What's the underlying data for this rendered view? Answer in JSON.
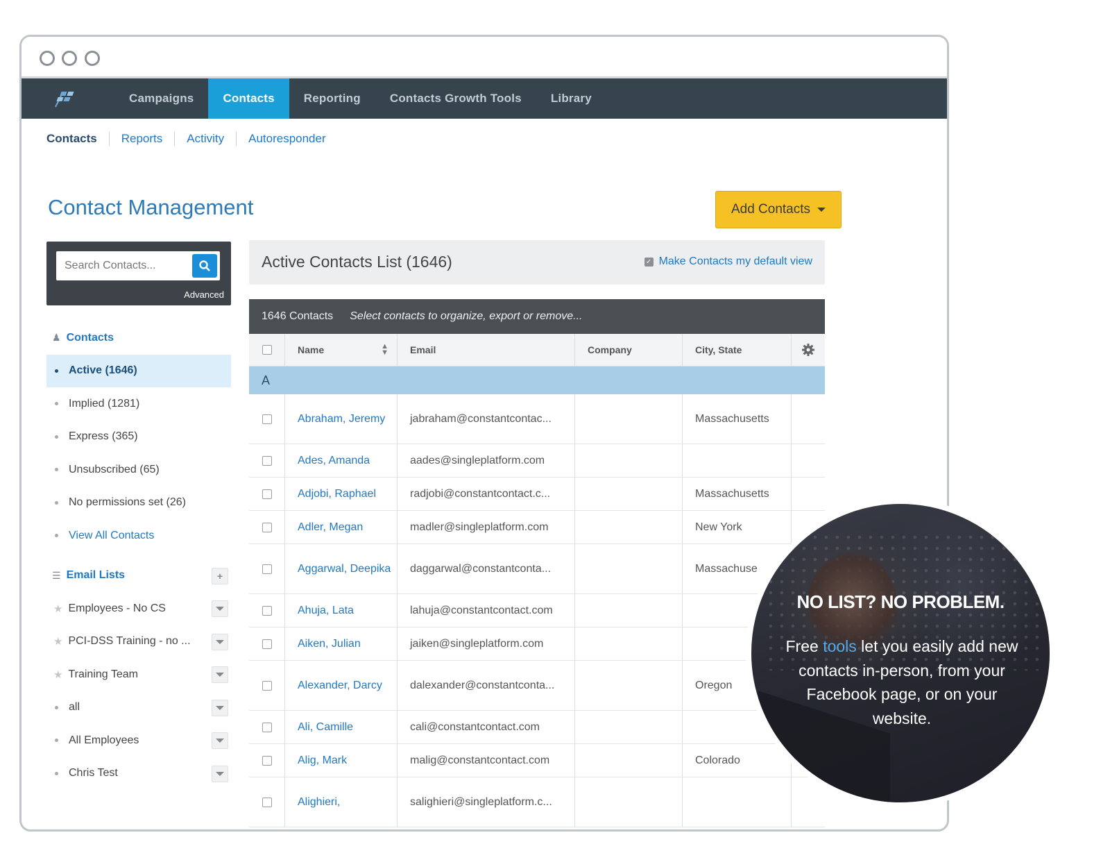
{
  "nav": {
    "items": [
      "Campaigns",
      "Contacts",
      "Reporting",
      "Contacts Growth Tools",
      "Library"
    ],
    "active": "Contacts"
  },
  "subnav": {
    "items": [
      "Contacts",
      "Reports",
      "Activity",
      "Autoresponder"
    ]
  },
  "page": {
    "title": "Contact Management",
    "add_button": "Add Contacts"
  },
  "search": {
    "placeholder": "Search Contacts...",
    "advanced": "Advanced"
  },
  "sidebar": {
    "contacts_header": "Contacts",
    "contacts": [
      "Active (1646)",
      "Implied (1281)",
      "Express (365)",
      "Unsubscribed (65)",
      "No permissions set (26)"
    ],
    "view_all": "View All Contacts",
    "lists_header": "Email Lists",
    "lists": [
      "Employees - No CS",
      "PCI-DSS Training - no ...",
      "Training Team",
      "all",
      "All Employees",
      "Chris Test"
    ]
  },
  "list": {
    "title": "Active Contacts List (1646)",
    "default_view": "Make Contacts my default view",
    "count_label": "1646 Contacts",
    "hint": "Select contacts to organize, export or remove...",
    "columns": {
      "name": "Name",
      "email": "Email",
      "company": "Company",
      "city": "City, State"
    },
    "group_letter": "A",
    "rows": [
      {
        "name": "Abraham, Jeremy",
        "email": "jabraham@constantcontac...",
        "company": "",
        "city": "Massachusetts"
      },
      {
        "name": "Ades, Amanda",
        "email": "aades@singleplatform.com",
        "company": "",
        "city": ""
      },
      {
        "name": "Adjobi, Raphael",
        "email": "radjobi@constantcontact.c...",
        "company": "",
        "city": "Massachusetts"
      },
      {
        "name": "Adler, Megan",
        "email": "madler@singleplatform.com",
        "company": "",
        "city": "New York"
      },
      {
        "name": "Aggarwal, Deepika",
        "email": "daggarwal@constantconta...",
        "company": "",
        "city": "Massachuse"
      },
      {
        "name": "Ahuja, Lata",
        "email": "lahuja@constantcontact.com",
        "company": "",
        "city": ""
      },
      {
        "name": "Aiken, Julian",
        "email": "jaiken@singleplatform.com",
        "company": "",
        "city": ""
      },
      {
        "name": "Alexander, Darcy",
        "email": "dalexander@constantconta...",
        "company": "",
        "city": "Oregon"
      },
      {
        "name": "Ali, Camille",
        "email": "cali@constantcontact.com",
        "company": "",
        "city": ""
      },
      {
        "name": "Alig, Mark",
        "email": "malig@constantcontact.com",
        "company": "",
        "city": "Colorado"
      },
      {
        "name": "Alighieri,",
        "email": "salighieri@singleplatform.c...",
        "company": "",
        "city": ""
      }
    ]
  },
  "promo": {
    "headline": "NO LIST? NO PROBLEM.",
    "body_pre": "Free ",
    "body_link": "tools",
    "body_post": " let you easily add new contacts in-person, from your Facebook page, or on your website."
  },
  "colors": {
    "nav_bg": "#36444e",
    "nav_active": "#1a9fd9",
    "accent_button": "#f5c124",
    "link": "#1f78c4"
  }
}
